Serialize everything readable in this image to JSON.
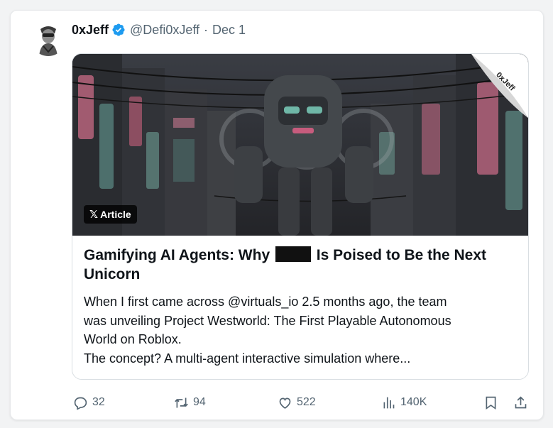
{
  "tweet": {
    "author_name": "0xJeff",
    "handle": "@Defi0xJeff",
    "separator": "·",
    "date": "Dec 1"
  },
  "article": {
    "badge_label": "Article",
    "badge_logo": "𝕏",
    "curl_label": "0xJeff",
    "title_before": "Gamifying AI Agents: Why ",
    "title_after": " Is Poised to Be the Next Unicorn",
    "excerpt_lines": [
      "When I first came across @virtuals_io 2.5 months ago, the team",
      "was unveiling Project Westworld: The First Playable Autonomous",
      "World on Roblox.",
      "The concept? A multi-agent interactive simulation where..."
    ]
  },
  "actions": {
    "replies": "32",
    "reposts": "94",
    "likes": "522",
    "views": "140K"
  },
  "colors": {
    "verified": "#1d9bf0",
    "muted_text": "#536471",
    "text": "#0f1419",
    "border": "#d9dee2"
  },
  "icons": [
    "verified-badge-icon",
    "reply-icon",
    "repost-icon",
    "like-icon",
    "views-icon",
    "bookmark-icon",
    "share-icon"
  ]
}
